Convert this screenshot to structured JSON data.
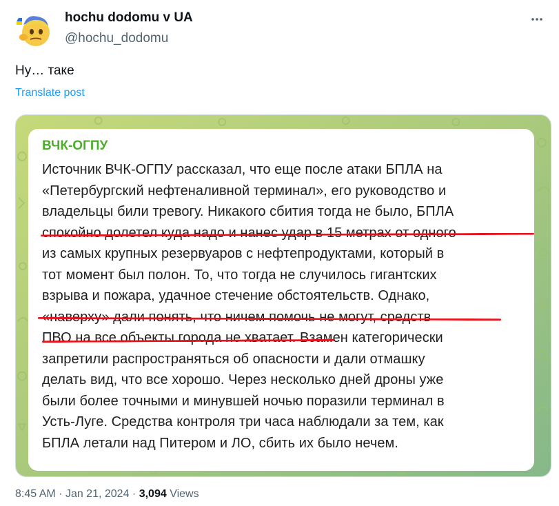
{
  "author": {
    "display_name": "hochu dodomu v UA",
    "handle": "@hochu_dodomu"
  },
  "tweet": {
    "text": "Ну… таке",
    "translate_label": "Translate post"
  },
  "post": {
    "channel": "ВЧК-ОГПУ",
    "lines": [
      "Источник ВЧК-ОГПУ рассказал, что еще после атаки БПЛА на",
      "«Петербургский нефтеналивной терминал», его руководство и",
      "владельцы били тревогу. Никакого сбития тогда не было, БПЛА",
      "спокойно долетел куда надо и нанес удар в 15 метрах от одного",
      "из самых крупных резервуаров с нефтепродуктами, который в",
      "тот момент был полон. То, что тогда не случилось гигантских",
      "взрыва и пожара, удачное стечение обстоятельств. Однако,",
      "«наверху» дали понять, что ничем помочь не могут, средств",
      "ПВО на все объекты города не хватает. Взамен категорически",
      "запретили распространяться об опасности и дали отмашку",
      "делать вид, что все хорошо. Через несколько дней дроны уже",
      "были более точными и минувшей ночью поразили терминал в",
      "Усть-Луге. Средства контроля три часа наблюдали за тем, как",
      "БПЛА летали над Питером и ЛО, сбить их было нечем."
    ],
    "underline_color": "#e5141e",
    "channel_color": "#4caf2a"
  },
  "meta": {
    "time": "8:45 AM",
    "separator": "·",
    "date": "Jan 21, 2024",
    "views_count": "3,094",
    "views_label": "Views"
  },
  "colors": {
    "link": "#1d9bf0",
    "secondary": "#536471"
  }
}
